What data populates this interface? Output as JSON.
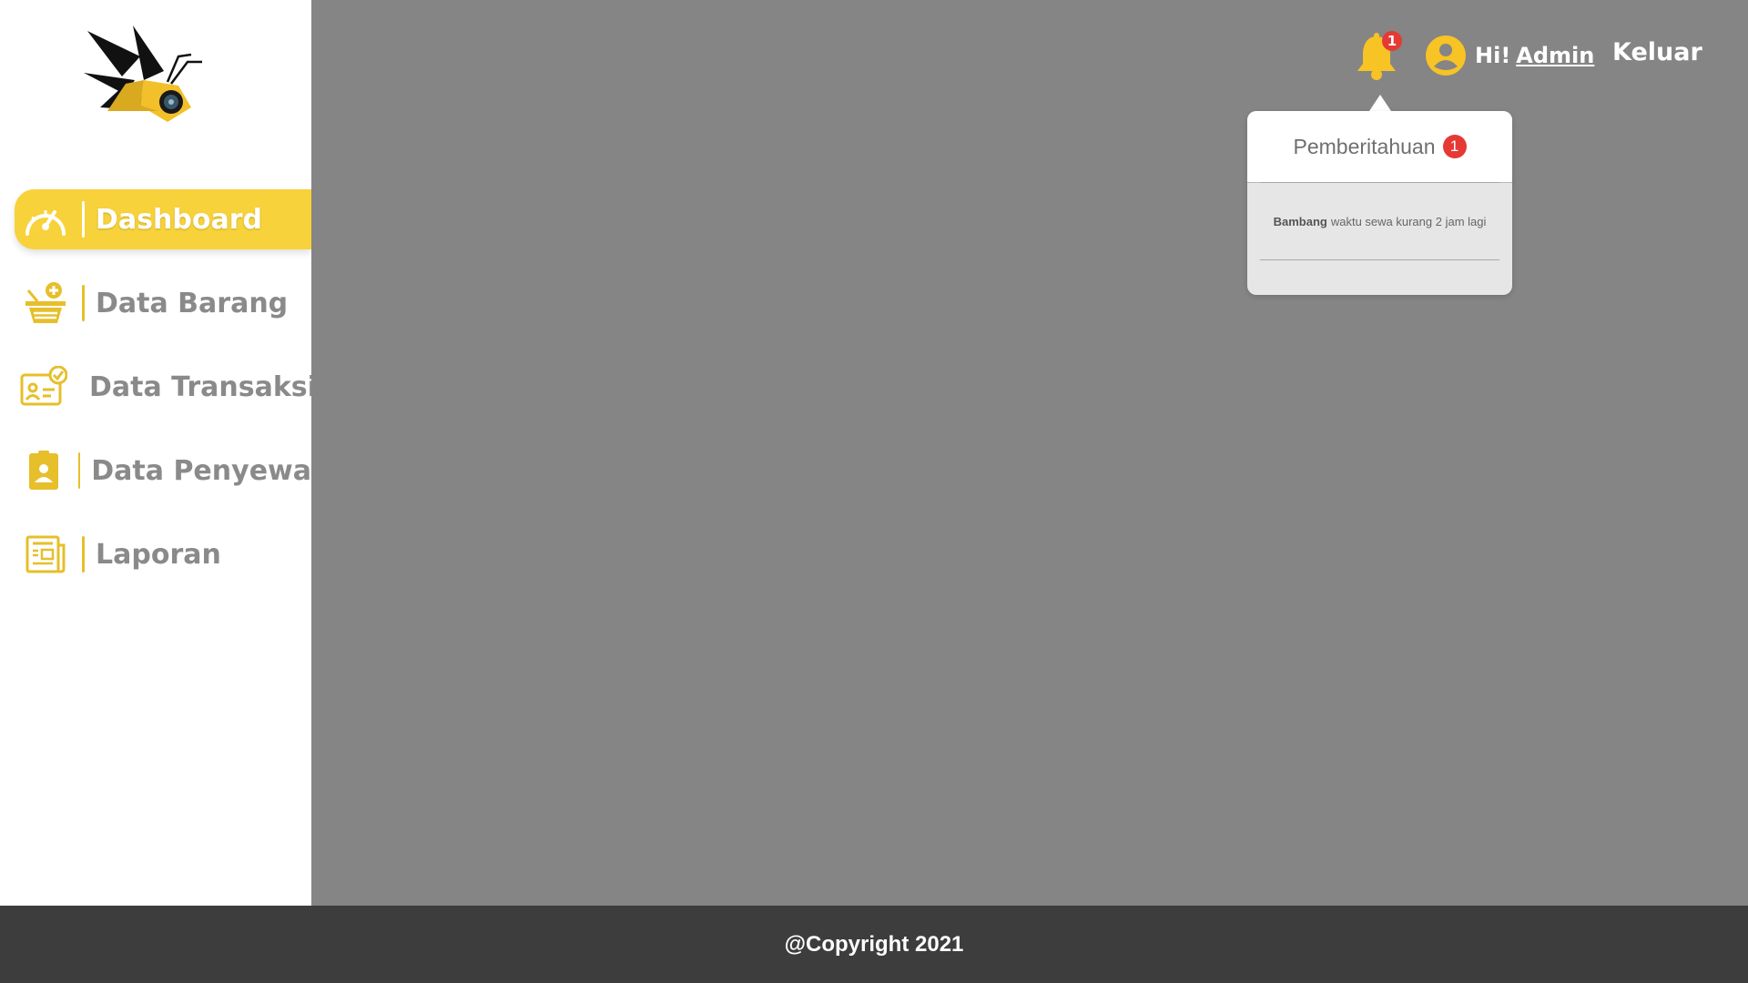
{
  "sidebar": {
    "items": [
      {
        "label": "Dashboard",
        "icon": "speedometer-icon",
        "active": true
      },
      {
        "label": "Data Barang",
        "icon": "basket-add-icon",
        "active": false
      },
      {
        "label": "Data Transaksi",
        "icon": "id-card-check-icon",
        "active": false
      },
      {
        "label": "Data Penyewa",
        "icon": "user-badge-icon",
        "active": false
      },
      {
        "label": "Laporan",
        "icon": "newspaper-icon",
        "active": false
      }
    ]
  },
  "header": {
    "notification_count": "1",
    "greeting": "Hi!",
    "username": "Admin",
    "logout_label": "Keluar"
  },
  "notifications": {
    "title": "Pemberitahuan",
    "count": "1",
    "items": [
      {
        "name": "Bambang",
        "message": "waktu sewa kurang 2 jam lagi"
      }
    ]
  },
  "footer": {
    "copyright": "@Copyright 2021"
  },
  "colors": {
    "accent": "#f7d23a",
    "main_bg": "#858585",
    "footer_bg": "#3d3d3d",
    "badge": "#e53935"
  }
}
